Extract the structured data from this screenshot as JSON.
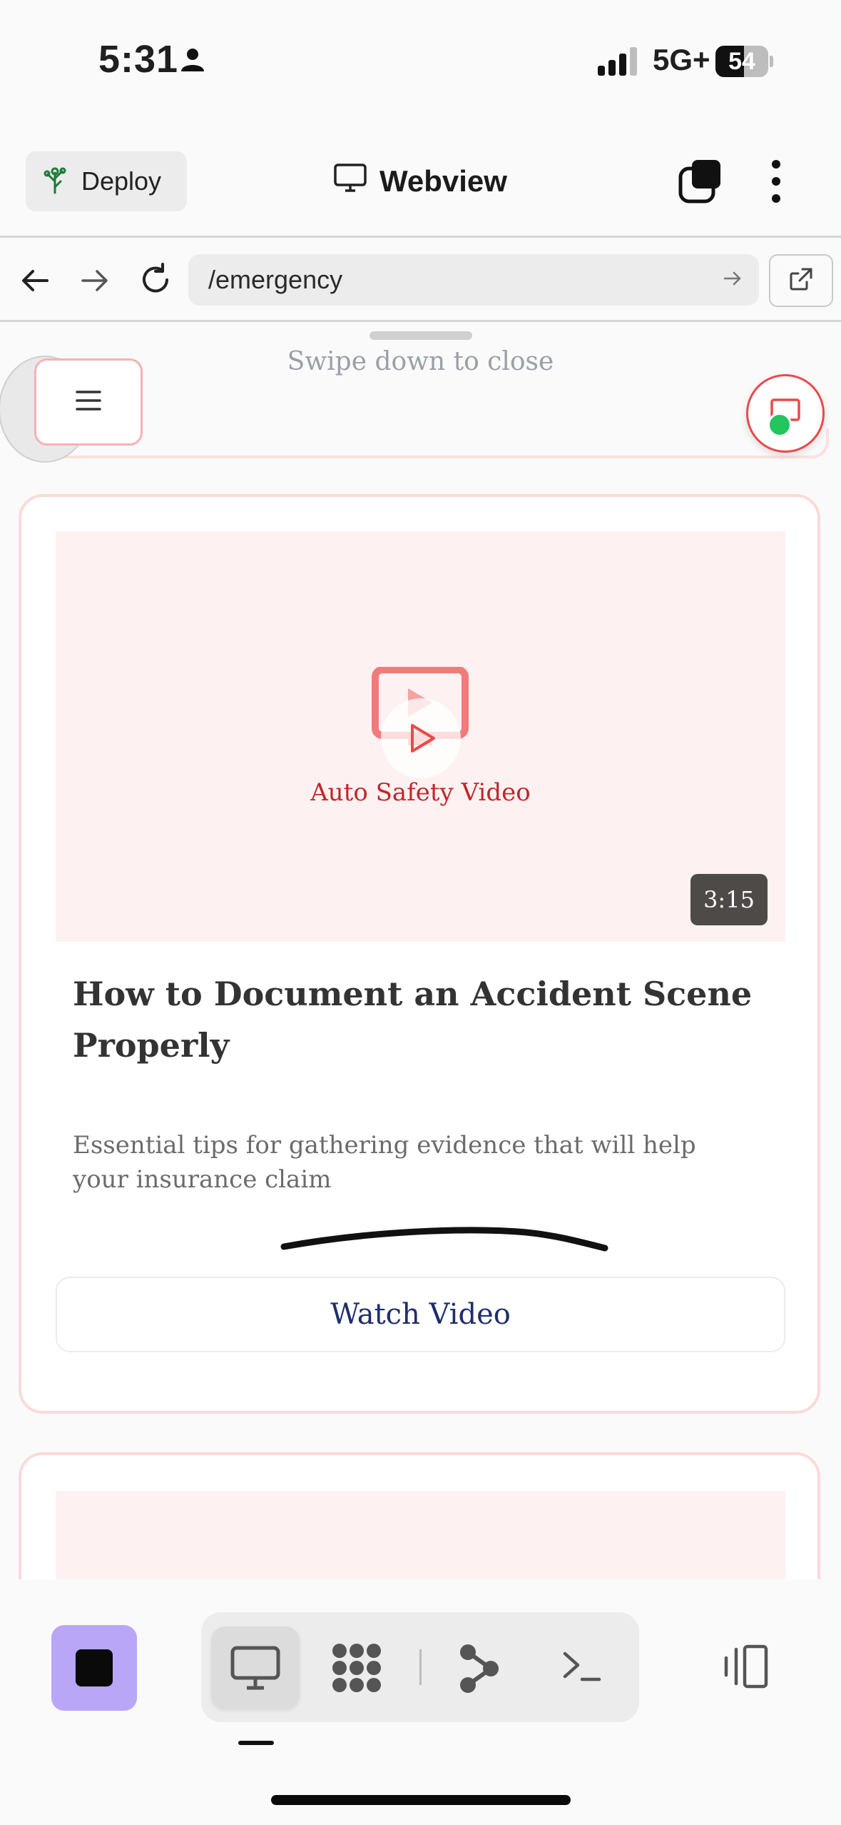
{
  "status_bar": {
    "time": "5:31",
    "network": "5G+",
    "battery_level": "54",
    "battery_fraction": 0.54
  },
  "app_header": {
    "deploy_label": "Deploy",
    "title": "Webview"
  },
  "browser": {
    "url": "/emergency"
  },
  "sheet": {
    "swipe_hint": "Swipe down to close"
  },
  "video_card": {
    "thumbnail_label": "Auto Safety Video",
    "duration": "3:15",
    "title": "How to Document an Accident Scene Properly",
    "description": "Essential tips for gathering evidence that will help your insurance claim",
    "button_label": "Watch Video"
  },
  "colors": {
    "accent_red": "#e84a4a",
    "thumbnail_bg": "#fef1f1",
    "stop_button_bg": "#b9a6f7",
    "live_dot": "#22c55e"
  },
  "icons": {
    "deploy": "tree-icon",
    "title": "monitor-icon",
    "tabs": "tabs-icon",
    "more": "more-vertical-icon",
    "back": "arrow-left-icon",
    "forward": "arrow-right-icon",
    "reload": "reload-icon",
    "go": "arrow-right-small-icon",
    "open_external": "external-link-icon",
    "menu": "hamburger-icon",
    "chat": "chat-icon",
    "video": "video-play-icon",
    "stop": "stop-icon",
    "desktop": "desktop-icon",
    "nodes": "nodes-icon",
    "branch": "branch-icon",
    "terminal": "terminal-icon",
    "panel": "panel-toggle-icon"
  }
}
